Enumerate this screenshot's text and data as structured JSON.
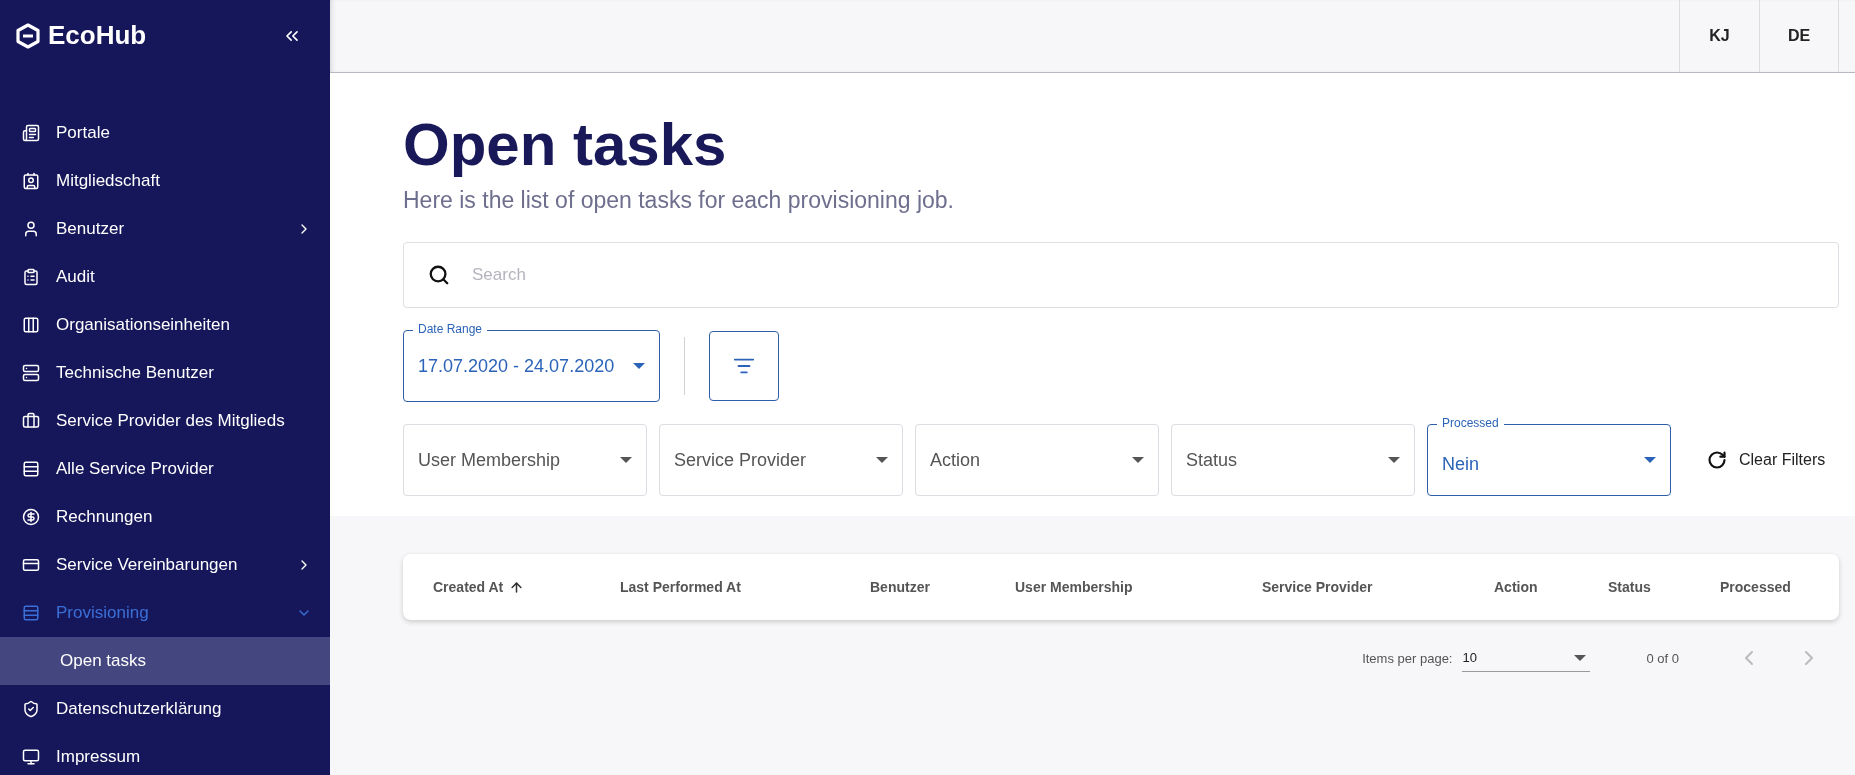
{
  "app": {
    "name": "EcoHub"
  },
  "sidebar": {
    "items": [
      {
        "label": "Portale",
        "selected": false
      },
      {
        "label": "Mitgliedschaft",
        "selected": false
      },
      {
        "label": "Benutzer",
        "selected": false,
        "expanded": false
      },
      {
        "label": "Audit",
        "selected": false
      },
      {
        "label": "Organisationseinheiten",
        "selected": false
      },
      {
        "label": "Technische Benutzer",
        "selected": false
      },
      {
        "label": "Service Provider des Mitglieds",
        "selected": false
      },
      {
        "label": "Alle Service Provider",
        "selected": false
      },
      {
        "label": "Rechnungen",
        "selected": false
      },
      {
        "label": "Service Vereinbarungen",
        "selected": false,
        "expanded": false
      },
      {
        "label": "Provisioning",
        "selected": true,
        "expanded": true,
        "children": [
          {
            "label": "Open tasks",
            "selected": true
          }
        ]
      },
      {
        "label": "Datenschutzerklärung",
        "selected": false
      },
      {
        "label": "Impressum",
        "selected": false
      }
    ]
  },
  "header": {
    "user": "KJ",
    "language": "DE"
  },
  "page": {
    "title": "Open tasks",
    "subtitle": "Here is the list of open tasks for each provisioning job."
  },
  "search": {
    "placeholder": "Search"
  },
  "date_range": {
    "label": "Date Range",
    "value": "17.07.2020 - 24.07.2020"
  },
  "filters": [
    {
      "placeholder": "User Membership"
    },
    {
      "placeholder": "Service Provider"
    },
    {
      "placeholder": "Action"
    },
    {
      "placeholder": "Status"
    },
    {
      "label": "Processed",
      "value": "Nein"
    }
  ],
  "clear_filters": "Clear Filters",
  "table": {
    "columns": [
      {
        "label": "Created At",
        "sorted": true
      },
      {
        "label": "Last Performed At"
      },
      {
        "label": "Benutzer"
      },
      {
        "label": "User Membership"
      },
      {
        "label": "Service Provider"
      },
      {
        "label": "Action"
      },
      {
        "label": "Status"
      },
      {
        "label": "Processed"
      }
    ]
  },
  "pagination": {
    "items_per_page_label": "Items per page:",
    "items_per_page": "10",
    "range": "0 of 0",
    "prev_disabled": true,
    "next_disabled": true
  }
}
